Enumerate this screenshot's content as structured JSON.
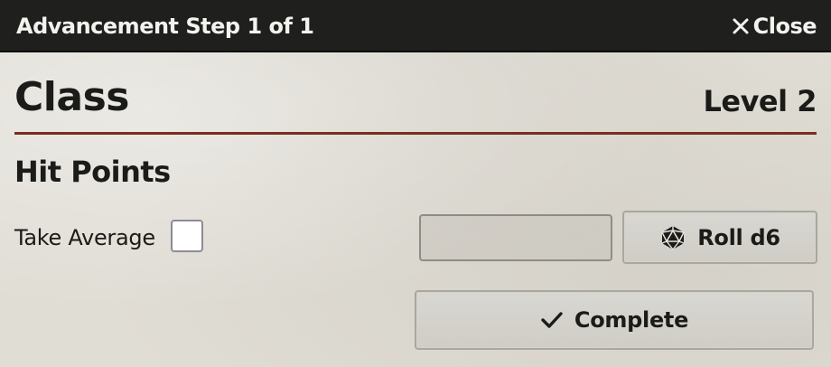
{
  "titlebar": {
    "title": "Advancement Step 1 of 1",
    "close_label": "Close",
    "close_icon": "close-icon"
  },
  "header": {
    "class_title": "Class",
    "level_label": "Level 2",
    "divider_color": "#7a2e1f"
  },
  "hit_points": {
    "section_title": "Hit Points",
    "take_average_label": "Take Average",
    "take_average_checked": false,
    "value": "",
    "roll_label": "Roll d6",
    "roll_icon": "d20-dice-icon"
  },
  "footer": {
    "complete_label": "Complete",
    "complete_icon": "checkmark-icon"
  }
}
